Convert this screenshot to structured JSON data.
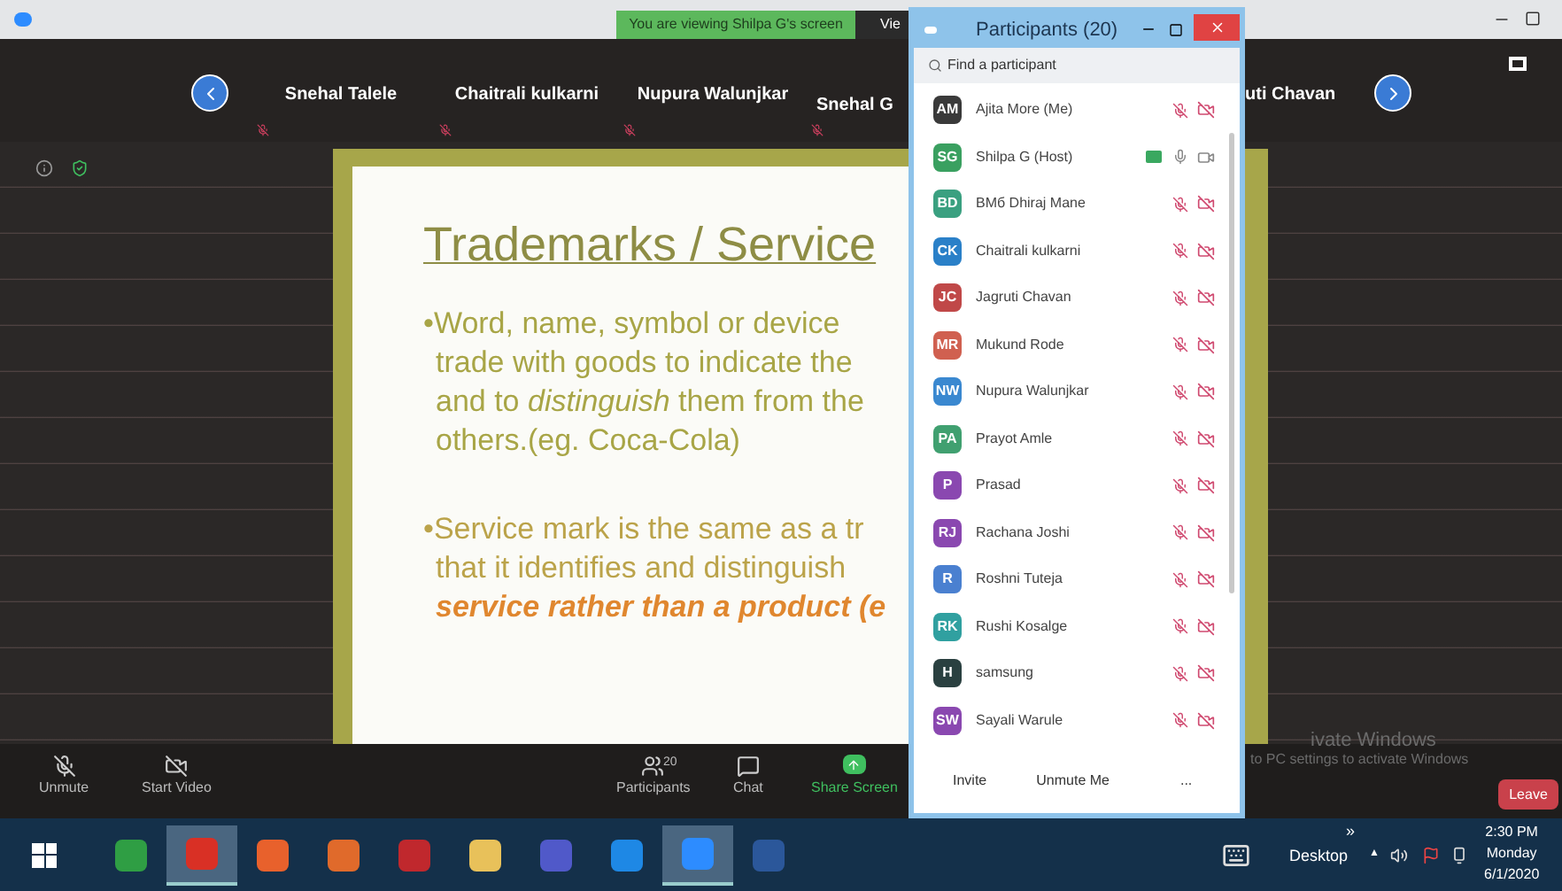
{
  "title_bar": {
    "banner": "You are viewing Shilpa G's screen",
    "view_button": "Vie"
  },
  "thumbnail_strip": {
    "names": [
      "Snehal Talele",
      "Chaitrali kulkarni",
      "Nupura Walunjkar",
      "Snehal G"
    ],
    "right_name": "uti Chavan"
  },
  "slide": {
    "title": "Trademarks / Service",
    "bullet_1": [
      "•Word, name, symbol or device",
      "trade with goods to indicate the",
      "and to *distinguish* them from the",
      "others.(eg. Coca-Cola)"
    ],
    "bullet_2": [
      "•Service mark is the same as a tr",
      "that it identifies and distinguish"
    ],
    "bullet_2_emphasis": "service rather than a product (e"
  },
  "participants_panel": {
    "title": "Participants (20)",
    "search": {
      "placeholder": "Find a participant"
    },
    "participants": [
      {
        "initials": "AM",
        "name": "Ajita More (Me)",
        "color": "#3a3a3a",
        "sharing": false,
        "mic_muted": true,
        "video_on": false
      },
      {
        "initials": "SG",
        "name": "Shilpa G (Host)",
        "color": "#3aa060",
        "sharing": true,
        "mic_muted": false,
        "video_on": true
      },
      {
        "initials": "BD",
        "name": "BMб Dhiraj Mane",
        "color": "#3aa080",
        "sharing": false,
        "mic_muted": true,
        "video_on": false
      },
      {
        "initials": "CK",
        "name": "Chaitrali kulkarni",
        "color": "#2a80c8",
        "sharing": false,
        "mic_muted": true,
        "video_on": false
      },
      {
        "initials": "JC",
        "name": "Jagruti Chavan",
        "color": "#c04848",
        "sharing": false,
        "mic_muted": true,
        "video_on": false
      },
      {
        "initials": "MR",
        "name": "Mukund Rode",
        "color": "#d06050",
        "sharing": false,
        "mic_muted": true,
        "video_on": false
      },
      {
        "initials": "NW",
        "name": "Nupura Walunjkar",
        "color": "#3a88d0",
        "sharing": false,
        "mic_muted": true,
        "video_on": false
      },
      {
        "initials": "PA",
        "name": "Prayot Amle",
        "color": "#40a070",
        "sharing": false,
        "mic_muted": true,
        "video_on": false
      },
      {
        "initials": "P",
        "name": "Prasad",
        "color": "#8a48b0",
        "sharing": false,
        "mic_muted": true,
        "video_on": false
      },
      {
        "initials": "RJ",
        "name": "Rachana Joshi",
        "color": "#8a48b0",
        "sharing": false,
        "mic_muted": true,
        "video_on": false
      },
      {
        "initials": "R",
        "name": "Roshni Tuteja",
        "color": "#4a80d0",
        "sharing": false,
        "mic_muted": true,
        "video_on": false
      },
      {
        "initials": "RK",
        "name": "Rushi Kosalge",
        "color": "#30a0a0",
        "sharing": false,
        "mic_muted": true,
        "video_on": false
      },
      {
        "initials": "H",
        "name": "samsung",
        "color": "#2a4040",
        "sharing": false,
        "mic_muted": true,
        "video_on": false
      },
      {
        "initials": "SW",
        "name": "Sayali Warule",
        "color": "#8a48b0",
        "sharing": false,
        "mic_muted": true,
        "video_on": false
      }
    ],
    "buttons": [
      "Invite",
      "Unmute Me",
      "..."
    ]
  },
  "toolbar": {
    "unmute": "Unmute",
    "start_video": "Start Video",
    "participants": "Participants",
    "participants_count": "20",
    "chat": "Chat",
    "share_screen": "Share Screen",
    "leave": "Leave"
  },
  "activation_notice": [
    "ivate Windows",
    "to PC settings to activate Windows"
  ],
  "taskbar": {
    "apps": [
      {
        "active": false
      },
      {
        "active": true
      },
      {
        "active": false
      },
      {
        "active": false
      },
      {
        "active": false
      },
      {
        "active": false
      },
      {
        "active": false
      },
      {
        "active": false
      },
      {
        "active": true
      },
      {
        "active": false
      }
    ],
    "desktop": "Desktop",
    "overflow": "»",
    "tray_caret": "▲",
    "time": "2:30 PM",
    "day": "Monday",
    "date": "6/1/2020"
  }
}
